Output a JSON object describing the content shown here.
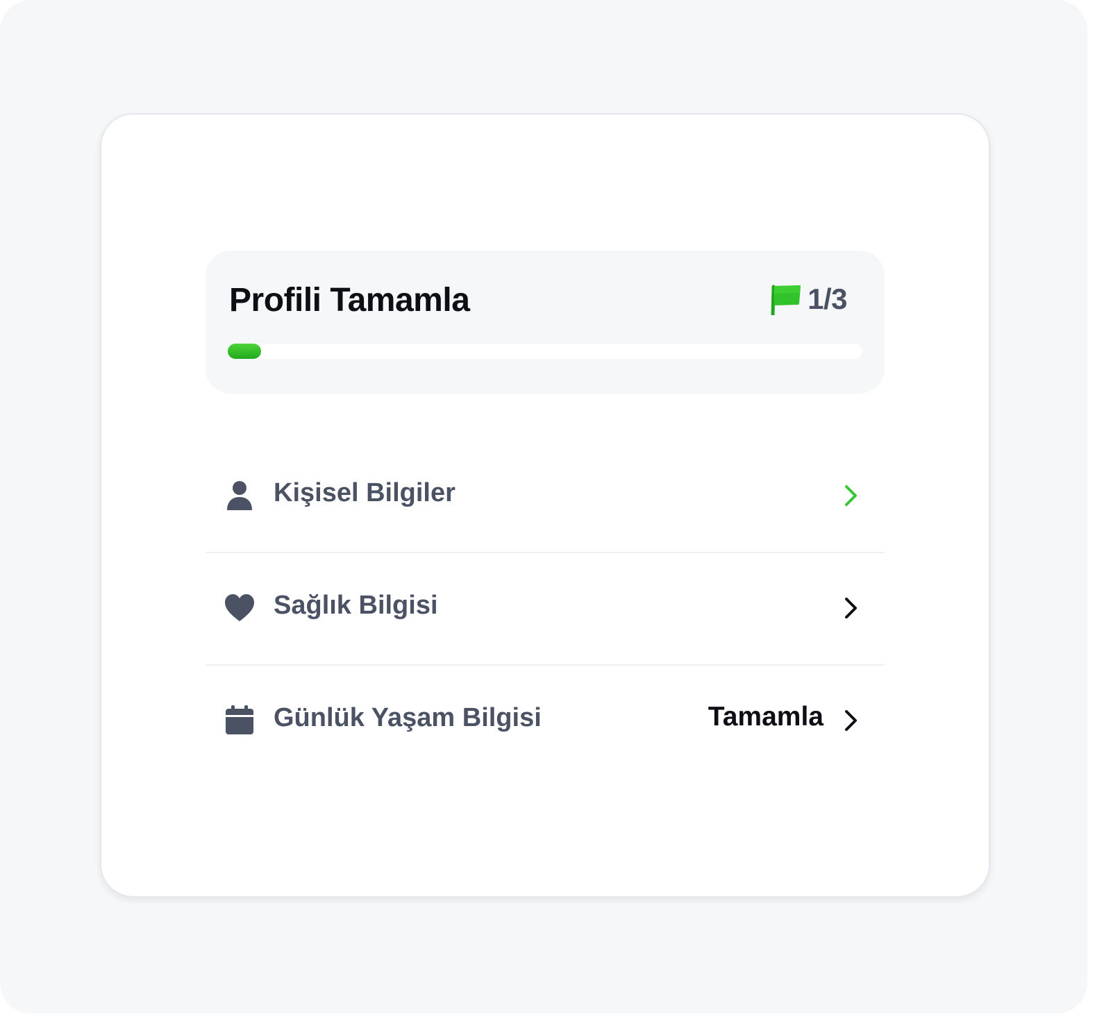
{
  "header": {
    "title": "Profili Tamamla",
    "count": "1/3",
    "progress_fraction": 0.052,
    "flag_icon": "flag-icon",
    "accent_color": "#2fbf26"
  },
  "steps": [
    {
      "icon": "person-icon",
      "label": "Kişisel Bilgiler",
      "action": "",
      "chevron_color": "#39c635"
    },
    {
      "icon": "heart-icon",
      "label": "Sağlık Bilgisi",
      "action": "",
      "chevron_color": "#0d0f14"
    },
    {
      "icon": "calendar-icon",
      "label": "Günlük Yaşam Bilgisi",
      "action": "Tamamla",
      "chevron_color": "#0d0f14"
    }
  ]
}
